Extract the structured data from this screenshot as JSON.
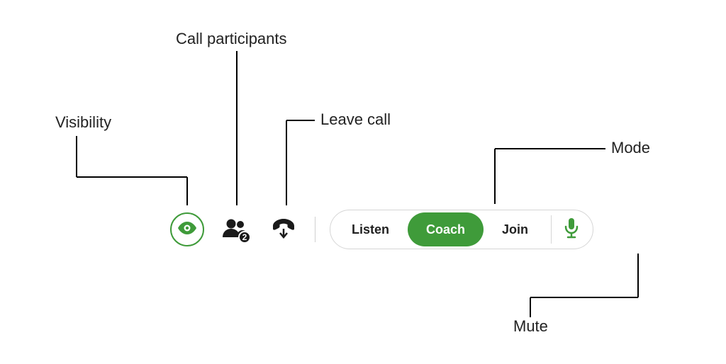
{
  "annotations": {
    "visibility": "Visibility",
    "participants": "Call participants",
    "leave": "Leave call",
    "mode": "Mode",
    "mute": "Mute"
  },
  "toolbar": {
    "participants_count": "2",
    "modes": {
      "listen": "Listen",
      "coach": "Coach",
      "join": "Join"
    },
    "active_mode": "coach"
  },
  "colors": {
    "accent": "#3f9b3a",
    "ink": "#1a1a1a"
  }
}
